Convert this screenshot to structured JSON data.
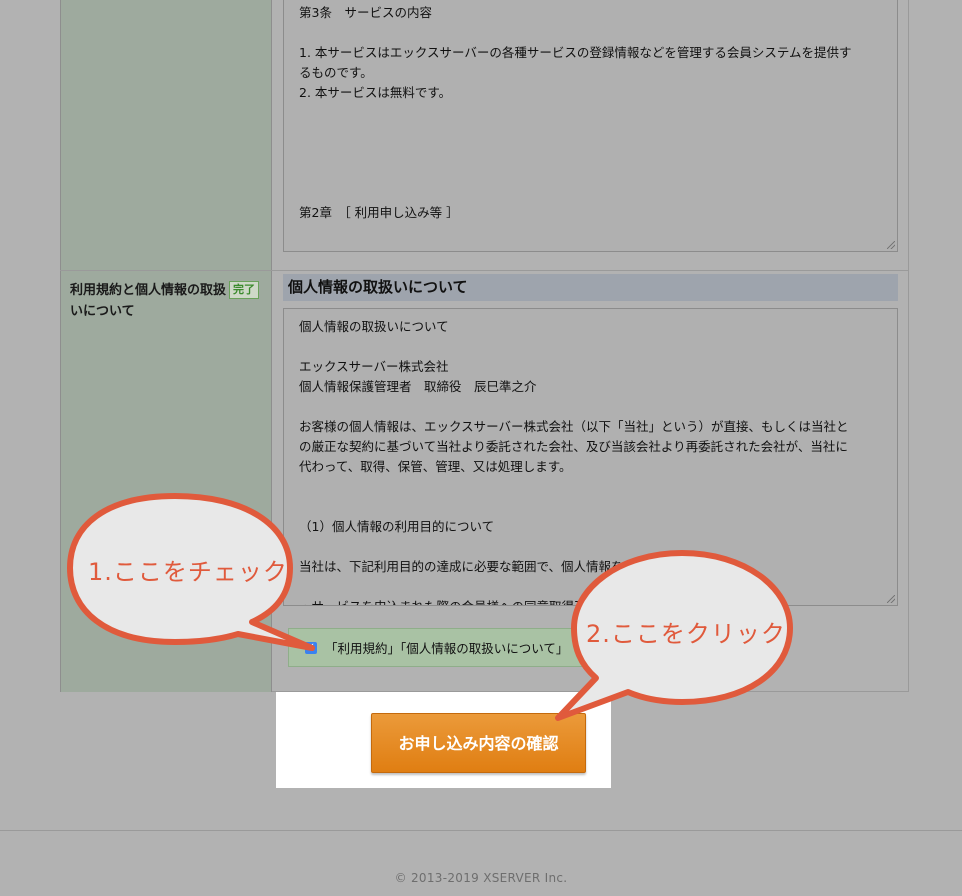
{
  "terms_box": {
    "lines": [
      "第3条　サービスの内容",
      "",
      "1. 本サービスはエックスサーバーの各種サービスの登録情報などを管理する会員システムを提供す",
      "るものです。",
      "2. 本サービスは無料です。",
      "",
      "",
      "",
      "",
      "",
      "第2章　［ 利用申し込み等 ］"
    ]
  },
  "field": {
    "label": "利用規約と個人情報の取扱いについて",
    "status_badge": "完了"
  },
  "privacy": {
    "heading": "個人情報の取扱いについて",
    "lines": [
      "個人情報の取扱いについて",
      "",
      "エックスサーバー株式会社",
      "個人情報保護管理者　取締役　辰巳準之介",
      "",
      "お客様の個人情報は、エックスサーバー株式会社（以下「当社」という）が直接、もしくは当社と",
      "の厳正な契約に基づいて当社より委託された会社、及び当該会社より再委託された会社が、当社に",
      "代わって、取得、保管、管理、又は処理します。",
      "",
      "",
      "（1）個人情報の利用目的について",
      "",
      "当社は、下記利用目的の達成に必要な範囲で、個人情報を",
      "",
      "・サービスを申込まれた際の会員様への同意取得及び確認のために"
    ]
  },
  "agreement": {
    "checked": true,
    "label": "「利用規約」「個人情報の取扱いについて」"
  },
  "submit": {
    "label": "お申し込み内容の確認"
  },
  "callouts": {
    "first": "1.ここをチェック",
    "second": "2.ここをクリック"
  },
  "footer": {
    "copyright": "© 2013-2019 XSERVER Inc."
  },
  "colors": {
    "page_dim": "#b2b2b2",
    "label_column": "#9eaa9e",
    "submit_orange": "#e38519",
    "callout_red": "#e05a3c",
    "callout_fill": "#e8e8e8"
  }
}
